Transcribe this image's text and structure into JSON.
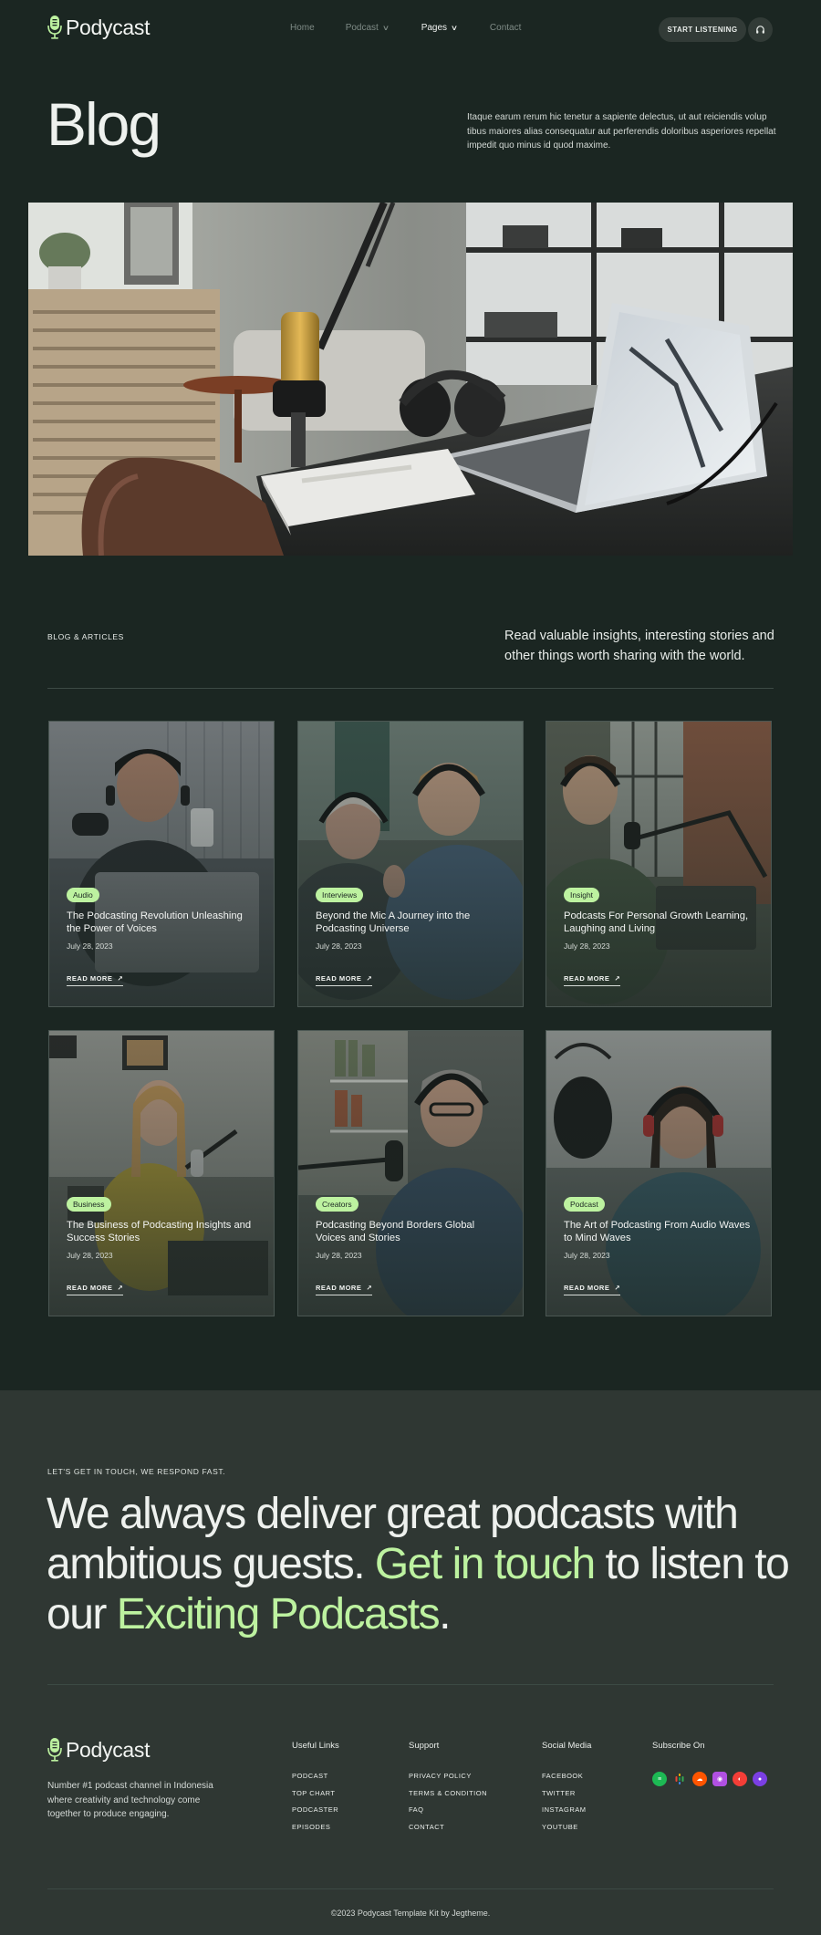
{
  "brand": {
    "name": "Podycast"
  },
  "nav": {
    "links": [
      {
        "label": "Home",
        "active": false,
        "dropdown": false
      },
      {
        "label": "Podcast",
        "active": false,
        "dropdown": true
      },
      {
        "label": "Pages",
        "active": true,
        "dropdown": true
      },
      {
        "label": "Contact",
        "active": false,
        "dropdown": false
      }
    ],
    "cta_label": "START LISTENING",
    "icon": "headphones-icon"
  },
  "hero": {
    "title": "Blog",
    "description": "Itaque earum rerum hic tenetur a sapiente delectus, ut aut reiciendis volup tibus maiores alias consequatur aut perferendis doloribus asperiores repellat impedit quo minus id quod maxime."
  },
  "blog": {
    "label": "BLOG & ARTICLES",
    "description": "Read valuable insights, interesting stories and other things worth sharing with the world.",
    "read_more_label": "READ MORE",
    "posts": [
      {
        "tag": "Audio",
        "title": "The Podcasting Revolution Unleashing the Power of Voices",
        "date": "July 28, 2023"
      },
      {
        "tag": "Interviews",
        "title": "Beyond the Mic A Journey into the Podcasting Universe",
        "date": "July 28, 2023"
      },
      {
        "tag": "Insight",
        "title": "Podcasts For Personal Growth Learning, Laughing and Living",
        "date": "July 28, 2023"
      },
      {
        "tag": "Business",
        "title": "The Business of Podcasting Insights and Success Stories",
        "date": "July 28, 2023"
      },
      {
        "tag": "Creators",
        "title": "Podcasting Beyond Borders Global Voices and Stories",
        "date": "July 28, 2023"
      },
      {
        "tag": "Podcast",
        "title": "The Art of Podcasting From Audio Waves to Mind Waves",
        "date": "July 28, 2023"
      }
    ]
  },
  "contact": {
    "label": "LET'S GET IN TOUCH, WE RESPOND FAST.",
    "headline_1": "We always deliver great podcasts with ambitious guests. ",
    "headline_accent_1": "Get in touch",
    "headline_2": " to listen to our ",
    "headline_accent_2": "Exciting Podcasts",
    "headline_3": "."
  },
  "footer": {
    "description": "Number #1 podcast channel in Indonesia where creativity and technology come together to produce engaging.",
    "columns": [
      {
        "title": "Useful Links",
        "items": [
          "PODCAST",
          "TOP CHART",
          "PODCASTER",
          "EPISODES"
        ]
      },
      {
        "title": "Support",
        "items": [
          "PRIVACY POLICY",
          "TERMS & CONDITION",
          "FAQ",
          "CONTACT"
        ]
      },
      {
        "title": "Social Media",
        "items": [
          "FACEBOOK",
          "TWITTER",
          "INSTAGRAM",
          "YOUTUBE"
        ]
      }
    ],
    "subscribe_title": "Subscribe On",
    "platforms": [
      {
        "icon": "spotify-icon",
        "color": "#1db954"
      },
      {
        "icon": "google-podcasts-icon",
        "color": "#f4b400"
      },
      {
        "icon": "soundcloud-icon",
        "color": "#ff5500"
      },
      {
        "icon": "apple-podcasts-icon",
        "color": "#b150e2"
      },
      {
        "icon": "pocket-casts-icon",
        "color": "#f43e37"
      },
      {
        "icon": "castbox-icon",
        "color": "#7b3fe4"
      }
    ],
    "copyright": "©2023 Podycast Template Kit by Jegtheme."
  },
  "colors": {
    "background": "#1b2622",
    "accent": "#bdf2a0",
    "footer_bg": "#2f3733"
  }
}
